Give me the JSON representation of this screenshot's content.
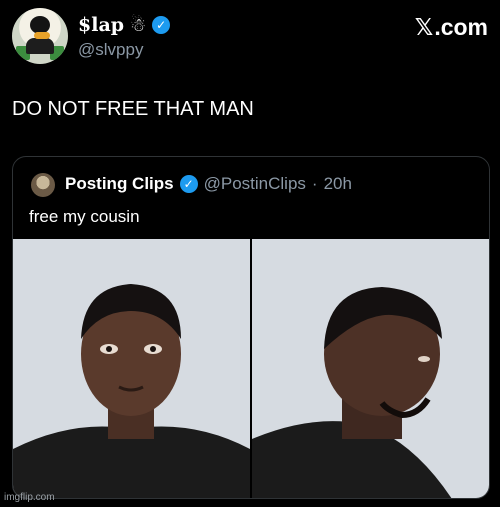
{
  "author": {
    "display_name": "$lap",
    "emoji": "☃",
    "handle": "@slvppy",
    "verified_icon": "verified-badge-icon"
  },
  "brand": {
    "mark": "𝕏",
    "label": ".com"
  },
  "tweet": {
    "text": "DO NOT FREE THAT MAN"
  },
  "quoted": {
    "display_name": "Posting Clips",
    "handle": "@PostinClips",
    "separator": "·",
    "time": "20h",
    "text": "free my cousin"
  },
  "watermark": "imgflip.com",
  "colors": {
    "accent": "#1d9bf0",
    "background": "#000000",
    "muted": "#8b98a5"
  }
}
